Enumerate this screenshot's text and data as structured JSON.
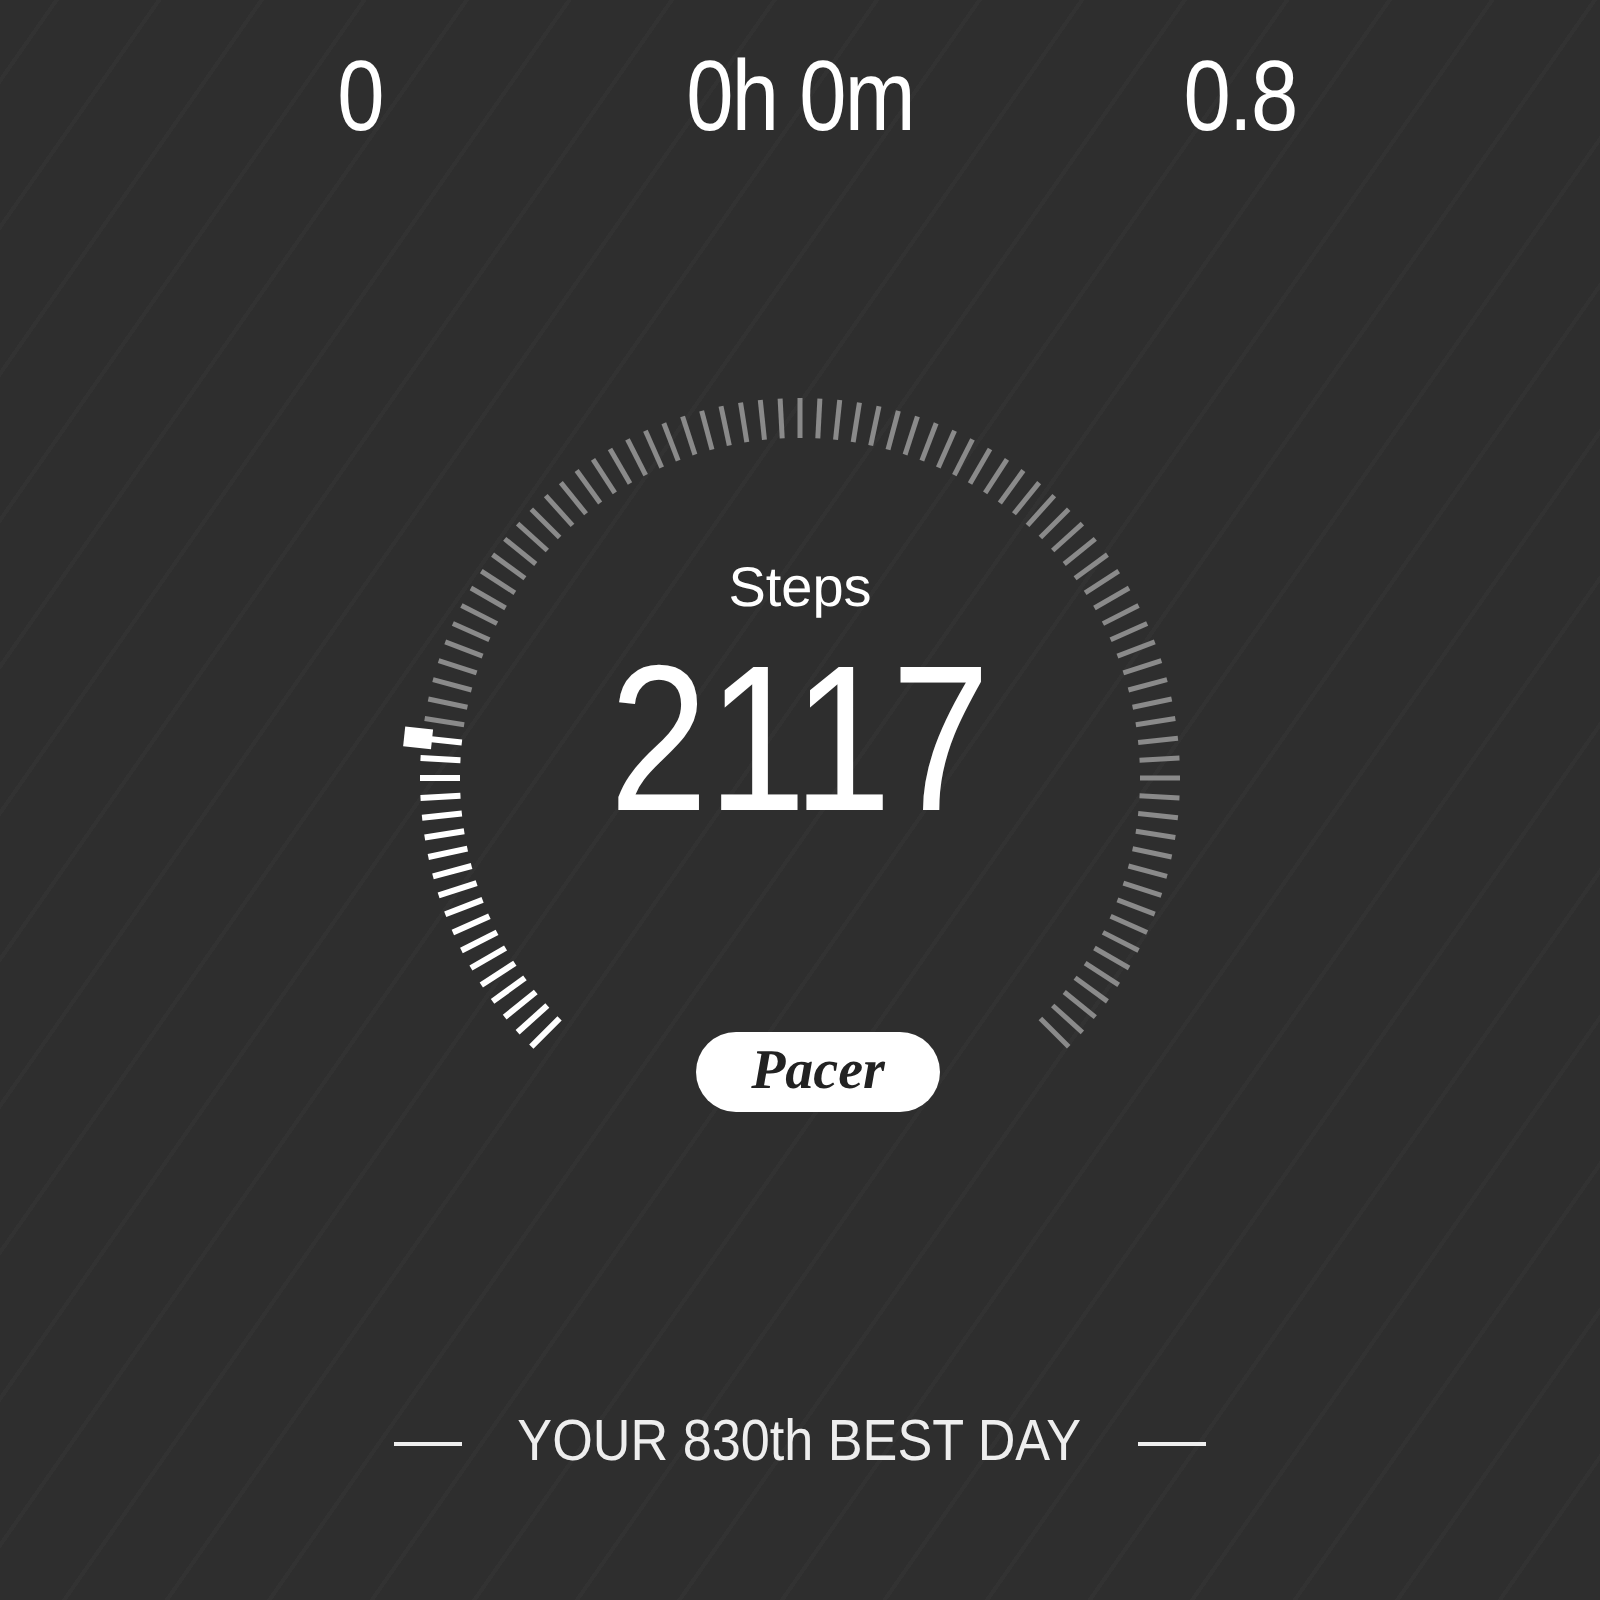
{
  "stats": [
    {
      "value": "0"
    },
    {
      "value": "0h 0m"
    },
    {
      "value": "0.8"
    }
  ],
  "gauge": {
    "label": "Steps",
    "value": "2117"
  },
  "logo": "Pacer",
  "rank": "YOUR 830th BEST DAY"
}
